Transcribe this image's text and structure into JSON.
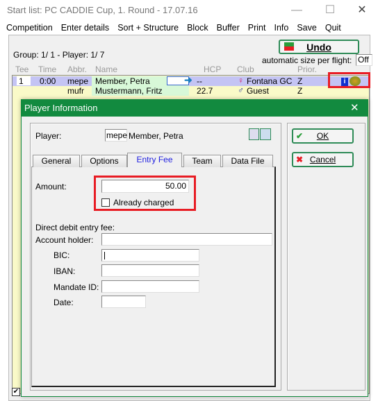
{
  "window": {
    "title": "Start list: PC CADDIE Cup, 1. Round - 17.07.16",
    "minimize": "—",
    "maximize": "☐",
    "close": "✕"
  },
  "menu": [
    "Competition",
    "Enter details",
    "Sort + Structure",
    "Block",
    "Buffer",
    "Print",
    "Info",
    "Save",
    "Quit"
  ],
  "toolbar": {
    "undo_label": "Undo",
    "auto_size_label": "automatic size per flight:",
    "auto_size_value": "Off",
    "group_status": "Group:  1/  1 - Player:  1/  7"
  },
  "columns": [
    "Tee",
    "Time",
    "Abbr.",
    "Name",
    "HCP",
    "Club",
    "Prior."
  ],
  "rows": [
    {
      "tee": "1",
      "time": "0:00",
      "abbr": "mepe",
      "name": "Member, Petra",
      "hcp": "--",
      "club": "Fontana GC",
      "prior": "Z",
      "gender": "female"
    },
    {
      "tee": "",
      "time": "",
      "abbr": "mufr",
      "name": "Mustermann, Fritz",
      "hcp": "22.7",
      "club": "Guest",
      "prior": "Z",
      "gender": "male"
    }
  ],
  "dialog": {
    "title": "Player Information",
    "close": "✕",
    "player_label": "Player:",
    "player_abbr": "mepe",
    "player_name": "Member, Petra",
    "tabs": [
      "General",
      "Options",
      "Entry Fee",
      "Team",
      "Data File"
    ],
    "active_tab": "Entry Fee",
    "amount_label": "Amount:",
    "amount_value": "50.00",
    "already_charged_label": "Already charged",
    "already_charged": false,
    "direct_debit_label": "Direct debit entry fee:",
    "account_holder_label": "Account holder:",
    "bic_label": "BIC:",
    "iban_label": "IBAN:",
    "mandate_label": "Mandate ID:",
    "date_label": "Date:",
    "ok_label": "OK",
    "cancel_label": "Cancel"
  },
  "colors": {
    "dialog_title": "#128a3f",
    "highlight": "#e81c24",
    "row_selected": "#c4c4f4",
    "row": "#fafac8"
  }
}
